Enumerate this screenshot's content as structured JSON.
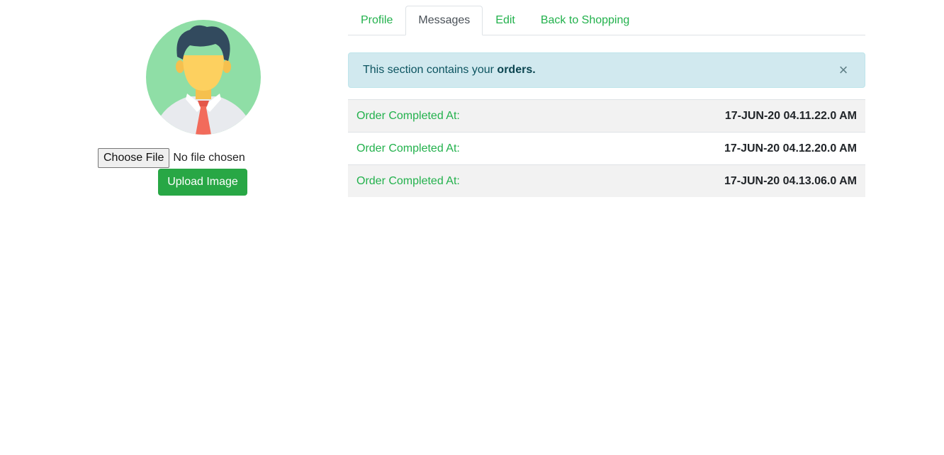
{
  "profile": {
    "avatar_icon": "user-avatar-icon",
    "file_input": {
      "button_label": "Choose File",
      "status_text": "No file chosen"
    },
    "upload_button_label": "Upload Image"
  },
  "tabs": [
    {
      "label": "Profile",
      "active": false
    },
    {
      "label": "Messages",
      "active": true
    },
    {
      "label": "Edit",
      "active": false
    },
    {
      "label": "Back to Shopping",
      "active": false
    }
  ],
  "alert": {
    "text_prefix": "This section contains your ",
    "text_bold": "orders.",
    "close_symbol": "×"
  },
  "orders": [
    {
      "label": "Order Completed At:",
      "time": "17-JUN-20 04.11.22.0 AM"
    },
    {
      "label": "Order Completed At:",
      "time": "17-JUN-20 04.12.20.0 AM"
    },
    {
      "label": "Order Completed At:",
      "time": "17-JUN-20 04.13.06.0 AM"
    }
  ],
  "colors": {
    "accent": "#22b14c",
    "button": "#28a745",
    "alert_bg": "#d1e9ef",
    "alert_text": "#0c5460"
  }
}
